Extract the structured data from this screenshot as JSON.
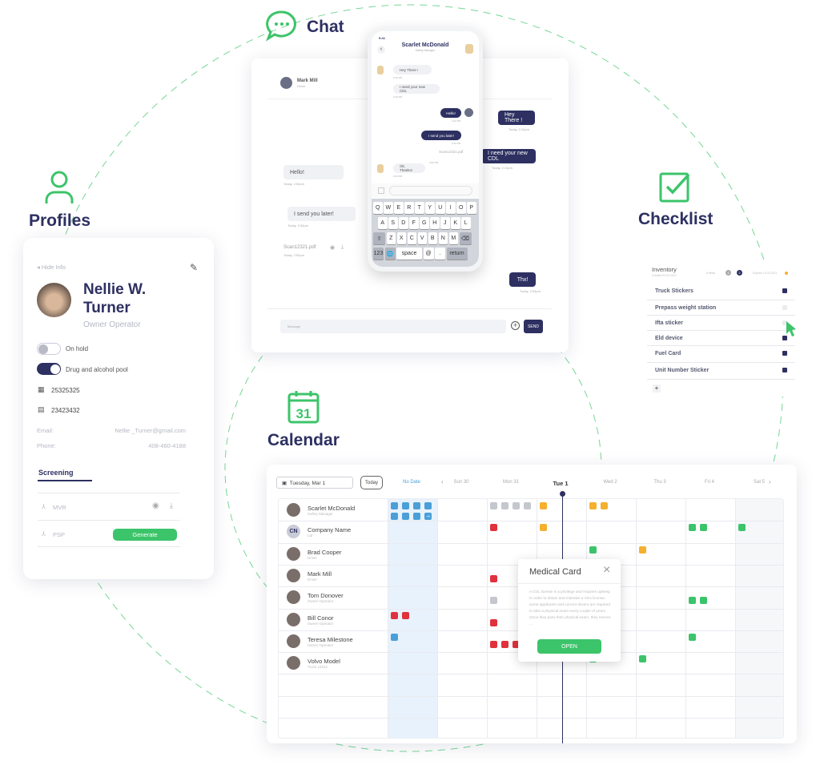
{
  "colors": {
    "navy": "#2d3061",
    "green": "#3cc46a",
    "blue": "#4a9fd8",
    "grey": "#c5c7cf",
    "orange": "#f5b02e",
    "red": "#e0323c"
  },
  "sections": {
    "chat": "Chat",
    "profiles": "Profiles",
    "checklist": "Checklist",
    "calendar": "Calendar"
  },
  "chat": {
    "contact_name": "Mark Mill",
    "contact_role": "Driver",
    "messages": [
      {
        "side": "out",
        "text": "Hey There !",
        "time": "Today, 2:12pm"
      },
      {
        "side": "out",
        "text": "I need your new CDL",
        "time": "Today, 2:13pm"
      },
      {
        "side": "in",
        "text": "Hello!",
        "time": "Today, 2:52pm"
      },
      {
        "side": "in",
        "text": "I send you later!",
        "time": "Today, 2:52pm"
      },
      {
        "side": "in",
        "text": "Scan12321.pdf",
        "time": "Today, 2:52pm",
        "file": true
      },
      {
        "side": "out",
        "text": "Thx!",
        "time": "Today, 2:54pm"
      }
    ],
    "message_placeholder": "Message",
    "send_label": "SEND"
  },
  "phone": {
    "time": "9:41",
    "contact_name": "Scarlet McDonald",
    "contact_role": "Safety Manager",
    "messages": [
      {
        "side": "in",
        "text": "Hey There !",
        "time": "2:22 PM"
      },
      {
        "side": "in",
        "text": "I need your new CDL",
        "time": "2:22 PM"
      },
      {
        "side": "out",
        "text": "Hello!",
        "time": "2:32 PM"
      },
      {
        "side": "out",
        "text": "I send you later!",
        "time": "2:32 PM"
      },
      {
        "side": "out",
        "text": "Scan12321.pdf",
        "time": "4:56 PM",
        "file": true
      },
      {
        "side": "in",
        "text": "Ok, Thanks!",
        "time": "2:50 PM"
      }
    ],
    "keyboard": [
      [
        "Q",
        "W",
        "E",
        "R",
        "T",
        "Y",
        "U",
        "I",
        "O",
        "P"
      ],
      [
        "A",
        "S",
        "D",
        "F",
        "G",
        "H",
        "J",
        "K",
        "L"
      ],
      [
        "⇧",
        "Z",
        "X",
        "C",
        "V",
        "B",
        "N",
        "M",
        "⌫"
      ],
      [
        "123",
        "🌐",
        "space",
        "@",
        ".",
        "return"
      ]
    ]
  },
  "profile": {
    "hide_info": "Hide Info",
    "name_line1": "Nellie W.",
    "name_line2": "Turner",
    "role": "Owner Operator",
    "toggles": [
      {
        "label": "On hold",
        "on": false
      },
      {
        "label": "Drug and alcohol pool",
        "on": true
      }
    ],
    "ids": [
      {
        "icon": "building-icon",
        "value": "25325325"
      },
      {
        "icon": "truck-icon",
        "value": "23423432"
      }
    ],
    "email_label": "Email:",
    "email": "Nellie _Turner@gmail.com",
    "phone_label": "Phone:",
    "phone": "408-460-4188",
    "tab": "Screening",
    "documents": [
      {
        "name": "MVR",
        "action": "view"
      },
      {
        "name": "PSP",
        "action": "Generate"
      }
    ]
  },
  "checklist": {
    "title": "Inventory",
    "created": "Created 01.02.2021",
    "fields": "6 fields",
    "count_a": "4",
    "count_b": "2",
    "expires": "Expires 14.02.2021",
    "items": [
      {
        "label": "Truck Stickers",
        "checked": true
      },
      {
        "label": "Prepass weight station",
        "checked": false
      },
      {
        "label": "Ifta sticker",
        "checked": false
      },
      {
        "label": "Eld device",
        "checked": true
      },
      {
        "label": "Fuel Card",
        "checked": true
      },
      {
        "label": "Unit Number Sticker",
        "checked": true
      }
    ],
    "add": "+"
  },
  "calendar": {
    "date_value": "Tuesday, Mar 1",
    "today": "Today",
    "columns": [
      "No Date",
      "Sun 30",
      "Mon 31",
      "Tue 1",
      "Wed 2",
      "Thu 3",
      "Fri 4",
      "Sat 5"
    ],
    "current_column": "Tue 1",
    "rows": [
      {
        "name": "Scarlet McDonald",
        "role": "Safety Manager",
        "events": [
          [
            "No Date",
            "blue",
            7
          ],
          [
            "No Date",
            "blue-more",
            1
          ],
          [
            "Mon 31",
            "grey",
            4
          ],
          [
            "Tue 1",
            "orange",
            1
          ],
          [
            "Wed 2",
            "orange",
            2
          ]
        ]
      },
      {
        "name": "Company Name",
        "role": "Ltd",
        "initials": "CN",
        "events": [
          [
            "Mon 31",
            "red",
            1
          ],
          [
            "Tue 1",
            "orange",
            1
          ],
          [
            "Fri 4",
            "green",
            2
          ],
          [
            "Sat 5",
            "green",
            1
          ]
        ]
      },
      {
        "name": "Brad Cooper",
        "role": "Driver",
        "events": [
          [
            "Wed 2",
            "green",
            1
          ],
          [
            "Thu 3",
            "orange",
            1
          ]
        ]
      },
      {
        "name": "Mark Mill",
        "role": "Driver",
        "events": [
          [
            "Mon 31",
            "red",
            1
          ]
        ]
      },
      {
        "name": "Tom Donover",
        "role": "Owner Operator",
        "events": [
          [
            "Mon 31",
            "grey",
            1
          ],
          [
            "Fri 4",
            "green",
            2
          ]
        ]
      },
      {
        "name": "Bill Conor",
        "role": "Owner Operator",
        "events": [
          [
            "No Date",
            "red",
            2
          ],
          [
            "Mon 31",
            "red",
            1
          ],
          [
            "Wed 2",
            "green",
            1
          ]
        ]
      },
      {
        "name": "Teresa Milestone",
        "role": "Owner Operator",
        "events": [
          [
            "No Date",
            "blue",
            1
          ],
          [
            "Mon 31",
            "red",
            3
          ],
          [
            "Fri 4",
            "green",
            1
          ]
        ]
      },
      {
        "name": "Volvo Model",
        "role": "Truck 12312",
        "events": [
          [
            "Wed 2",
            "green",
            1
          ],
          [
            "Thu 3",
            "green",
            1
          ]
        ]
      }
    ],
    "more_label": "+9",
    "popup": {
      "title": "Medical Card",
      "body": "A CDL license is a privilege and requires upkeep. In order to obtain and maintain a CDL license, some applicants and current drivers are required to take a physical exam every couple of years. Once they pass their physical exam, they receive ...",
      "button": "OPEN"
    }
  }
}
